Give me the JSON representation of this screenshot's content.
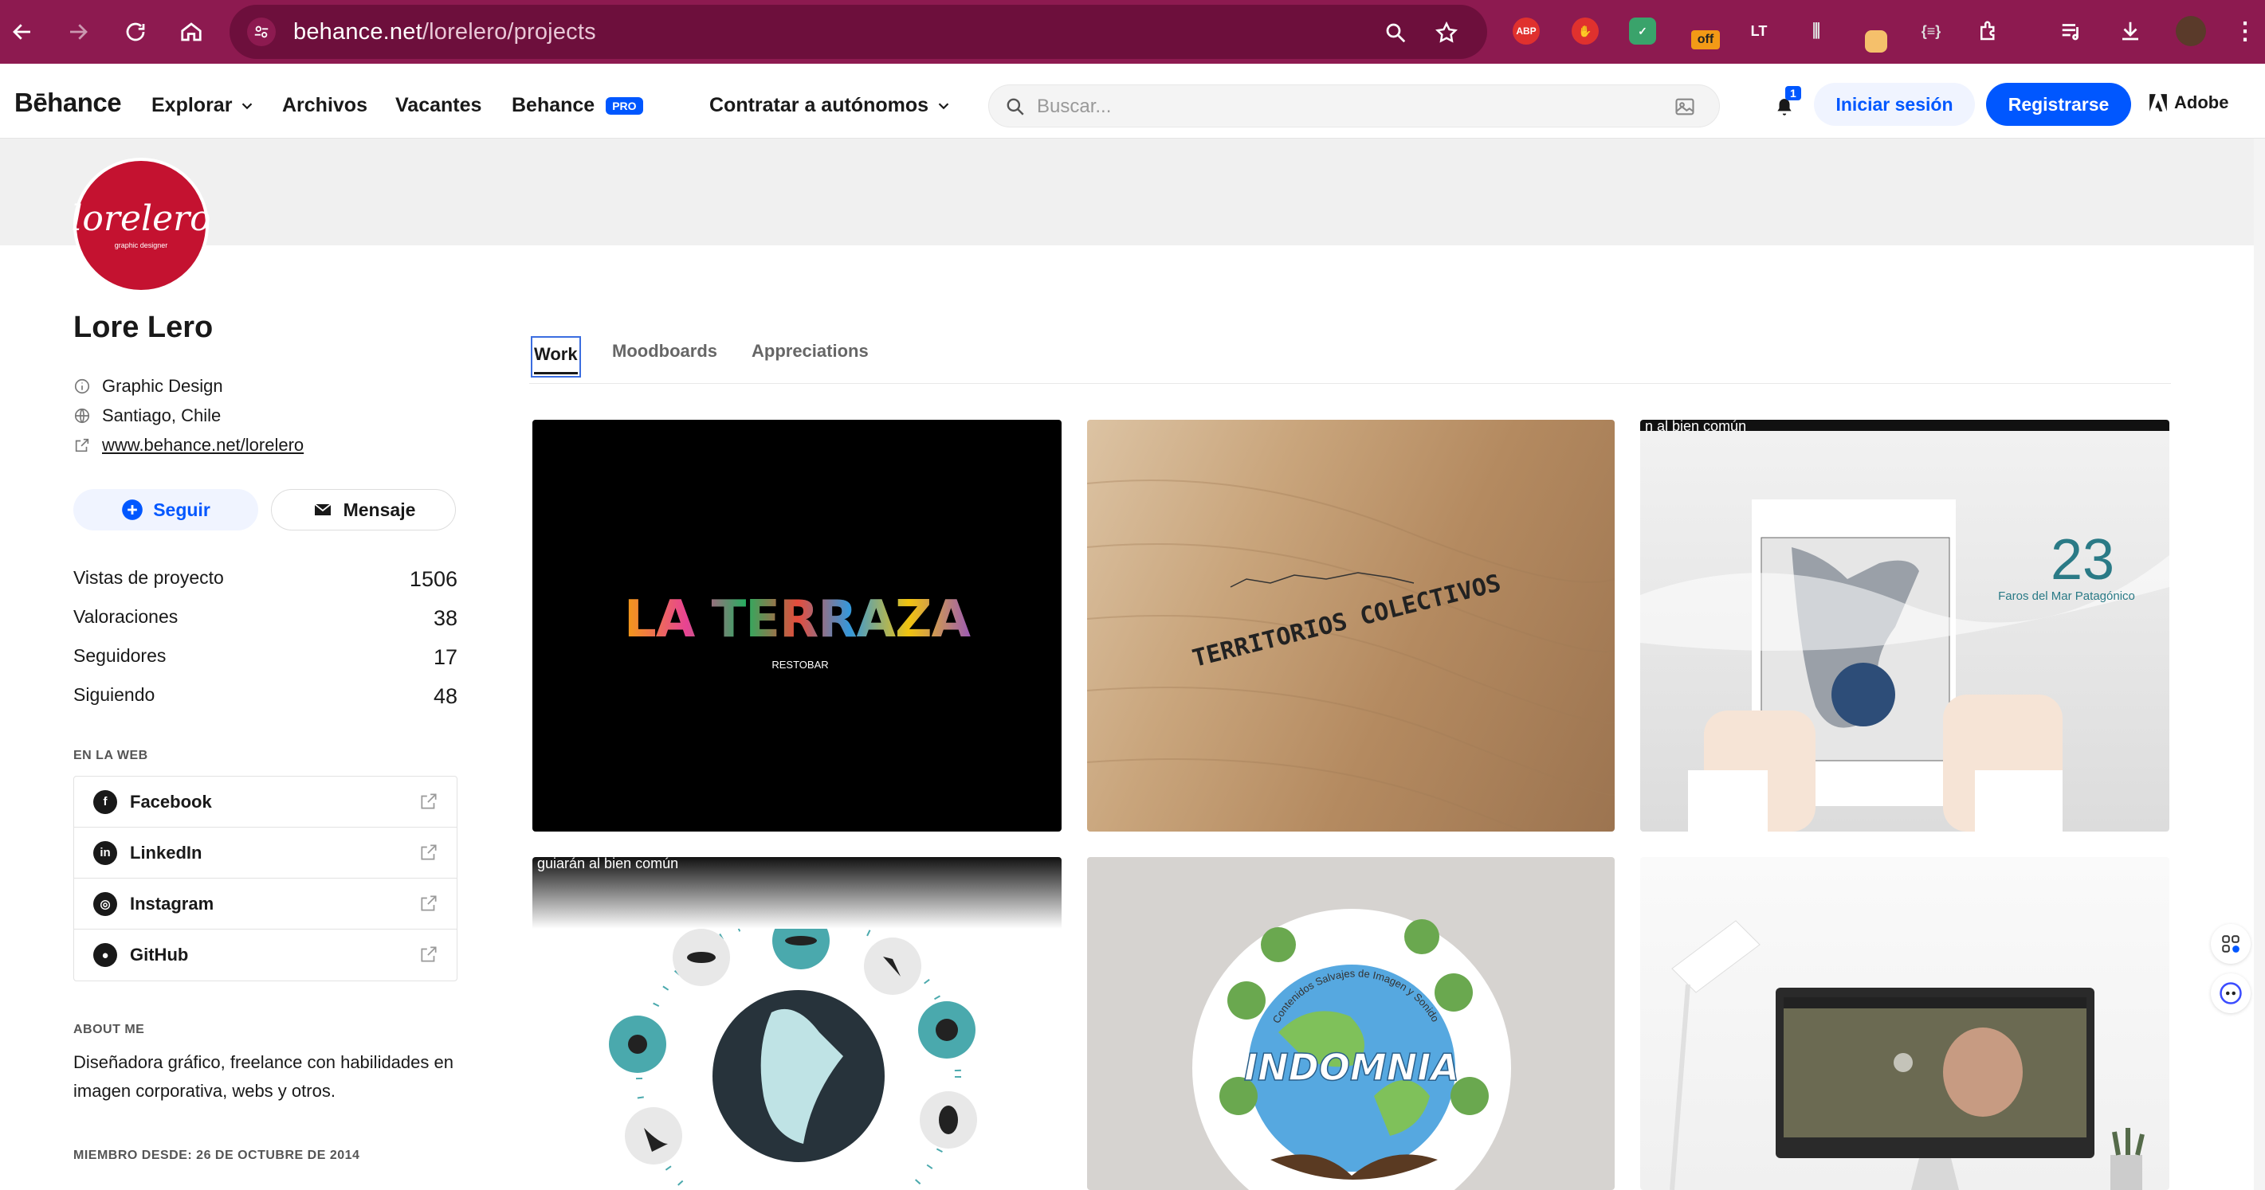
{
  "browser": {
    "url_host": "behance.net",
    "url_path": "/lorelero/projects",
    "ext_abp": "ABP",
    "ext_off": "off"
  },
  "nav": {
    "logo": "Bēhance",
    "explore": "Explorar",
    "archives": "Archivos",
    "jobs": "Vacantes",
    "behance": "Behance",
    "pro": "PRO",
    "hire": "Contratar a autónomos",
    "search_placeholder": "Buscar...",
    "notification_count": "1",
    "login": "Iniciar sesión",
    "signup": "Registrarse",
    "adobe": "Adobe"
  },
  "profile": {
    "avatar_text": "lorelero",
    "avatar_tag": "graphic designer",
    "name": "Lore Lero",
    "occupation": "Graphic Design",
    "location": "Santiago, Chile",
    "website": "www.behance.net/lorelero",
    "follow": "Seguir",
    "message": "Mensaje"
  },
  "stats": [
    {
      "label": "Vistas de proyecto",
      "value": "1506"
    },
    {
      "label": "Valoraciones",
      "value": "38"
    },
    {
      "label": "Seguidores",
      "value": "17"
    },
    {
      "label": "Siguiendo",
      "value": "48"
    }
  ],
  "web": {
    "heading": "EN LA WEB",
    "links": [
      {
        "label": "Facebook",
        "icon": "facebook-icon"
      },
      {
        "label": "LinkedIn",
        "icon": "linkedin-icon"
      },
      {
        "label": "Instagram",
        "icon": "instagram-icon"
      },
      {
        "label": "GitHub",
        "icon": "github-icon"
      }
    ]
  },
  "about": {
    "heading": "ABOUT ME",
    "text": "Diseñadora gráfico, freelance con habilidades en imagen corporativa, webs y otros.",
    "member_since": "MIEMBRO DESDE: 26 DE OCTUBRE DE 2014"
  },
  "tabs": [
    "Work",
    "Moodboards",
    "Appreciations"
  ],
  "projects": [
    {
      "title": "LA TERRAZA",
      "subtitle": "RESTOBAR",
      "caption": ""
    },
    {
      "title": "TERRITORIOS COLECTIVOS",
      "caption": ""
    },
    {
      "caption": "n al bien común",
      "number": "23",
      "number_label": "Faros del Mar Patagónico"
    },
    {
      "caption": "guiarán al bien común"
    },
    {
      "title": "INDOMNIA",
      "ring": "Contenidos Salvajes de Imagen y Sonido"
    },
    {
      "caption": ""
    }
  ],
  "colors": {
    "browser_frame": "#8d1a50",
    "accent": "#0057ff",
    "avatar_red": "#c41230"
  }
}
